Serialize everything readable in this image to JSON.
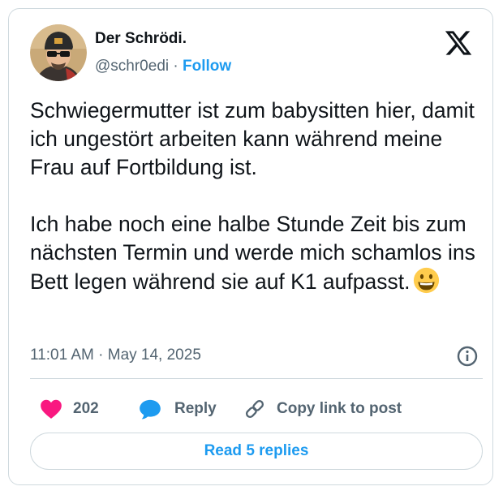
{
  "author": {
    "name": "Der Schrödi.",
    "handle": "@schr0edi",
    "separator": "·",
    "follow_label": "Follow"
  },
  "tweet": {
    "paragraphs": [
      "Schwiegermutter ist zum babysitten hier, damit ich ungestört arbeiten kann während meine Frau auf Fortbildung ist.",
      "Ich habe noch eine halbe Stunde Zeit bis zum nächsten Termin und werde mich schamlos ins Bett legen während sie auf K1 aufpasst."
    ],
    "emoji": "grinning-face",
    "timestamp": "11:01 AM · May 14, 2025"
  },
  "actions": {
    "like_count": "202",
    "reply_label": "Reply",
    "copy_label": "Copy link to post"
  },
  "read_replies_label": "Read 5 replies",
  "colors": {
    "accent": "#1d9bf0",
    "heart": "#f91880",
    "text": "#0f1419",
    "muted": "#536471",
    "border": "#cfd9de"
  },
  "icons": [
    "x-logo-icon",
    "info-icon",
    "heart-icon",
    "reply-bubble-icon",
    "link-icon"
  ]
}
